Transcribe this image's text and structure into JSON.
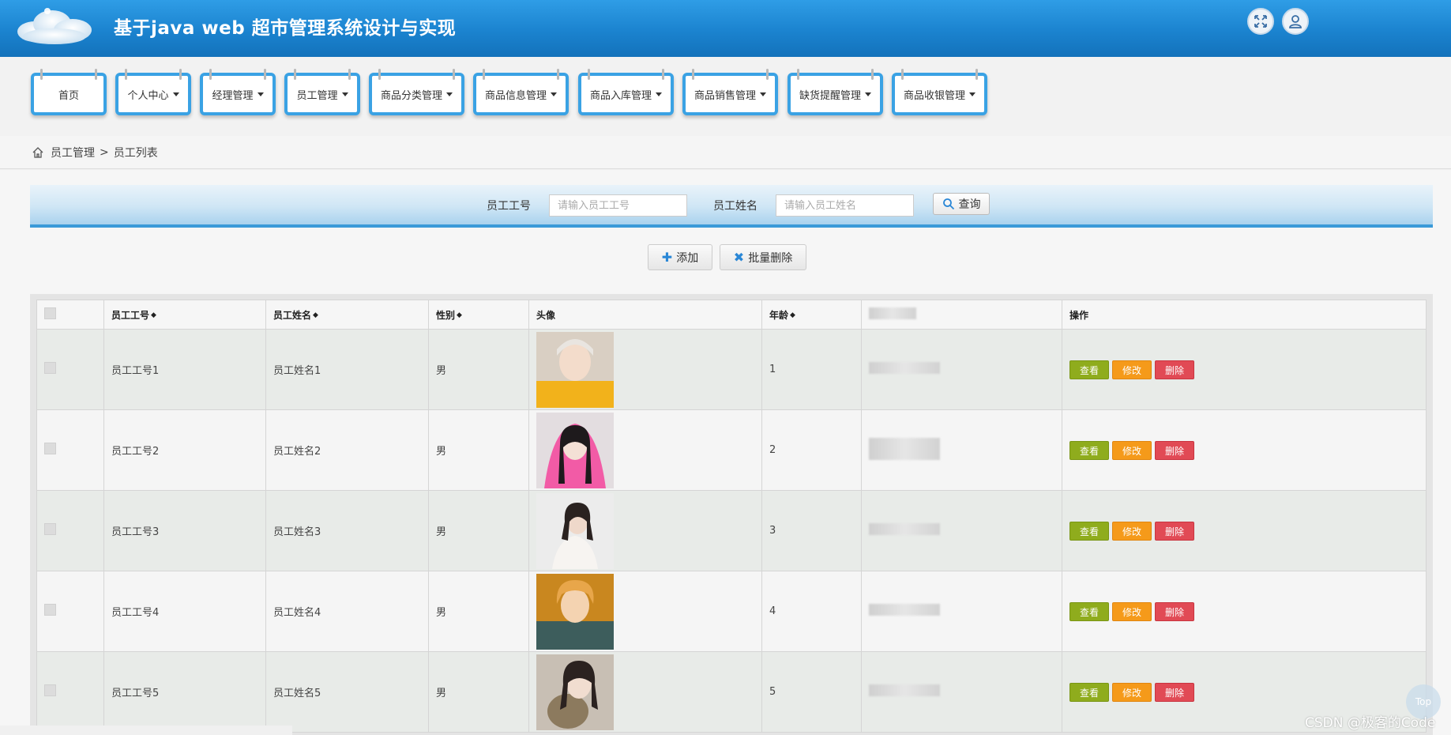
{
  "header": {
    "title": "基于java web 超市管理系统设计与实现",
    "fullscreen_icon": "expand-arrows-icon",
    "user_icon": "user-icon"
  },
  "nav": {
    "items": [
      {
        "label": "首页",
        "dropdown": false
      },
      {
        "label": "个人中心",
        "dropdown": true
      },
      {
        "label": "经理管理",
        "dropdown": true
      },
      {
        "label": "员工管理",
        "dropdown": true
      },
      {
        "label": "商品分类管理",
        "dropdown": true
      },
      {
        "label": "商品信息管理",
        "dropdown": true
      },
      {
        "label": "商品入库管理",
        "dropdown": true
      },
      {
        "label": "商品销售管理",
        "dropdown": true
      },
      {
        "label": "缺货提醒管理",
        "dropdown": true
      },
      {
        "label": "商品收银管理",
        "dropdown": true
      }
    ]
  },
  "breadcrumb": {
    "parent": "员工管理",
    "separator": ">",
    "current": "员工列表"
  },
  "search": {
    "id_label": "员工工号",
    "id_placeholder": "请输入员工工号",
    "name_label": "员工姓名",
    "name_placeholder": "请输入员工姓名",
    "query_label": "查询"
  },
  "actions": {
    "add_label": "添加",
    "batch_delete_label": "批量删除"
  },
  "table": {
    "columns": [
      "员工工号",
      "员工姓名",
      "性别",
      "头像",
      "年龄",
      "操作"
    ],
    "rows": [
      {
        "id": "员工工号1",
        "name": "员工姓名1",
        "gender": "男",
        "age": "1"
      },
      {
        "id": "员工工号2",
        "name": "员工姓名2",
        "gender": "男",
        "age": "2"
      },
      {
        "id": "员工工号3",
        "name": "员工姓名3",
        "gender": "男",
        "age": "3"
      },
      {
        "id": "员工工号4",
        "name": "员工姓名4",
        "gender": "男",
        "age": "4"
      },
      {
        "id": "员工工号5",
        "name": "员工姓名5",
        "gender": "男",
        "age": "5"
      }
    ],
    "op_labels": {
      "view": "查看",
      "edit": "修改",
      "delete": "删除"
    }
  },
  "misc": {
    "watermark": "CSDN @极客的Code",
    "top_label": "Top"
  },
  "colors": {
    "header_blue": "#1b83cf",
    "nav_border": "#3aa2e4",
    "view_btn": "#8fac1d",
    "edit_btn": "#f59a1a",
    "delete_btn": "#e14a55"
  }
}
